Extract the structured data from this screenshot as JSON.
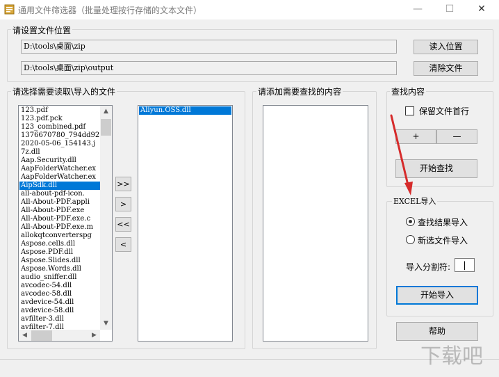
{
  "window": {
    "title": "通用文件筛选器（批量处理按行存储的文本文件）",
    "minimize_glyph": "—",
    "maximize_glyph": "☐",
    "close_glyph": "✕"
  },
  "location_group": {
    "label": "请设置文件位置",
    "path1": "D:\\tools\\桌面\\zip",
    "path2": "D:\\tools\\桌面\\zip\\output",
    "read_button": "读入位置",
    "clear_button": "清除文件"
  },
  "files_group": {
    "label": "请选择需要读取\\导入的文件",
    "source_files": [
      "123.pdf",
      "123.pdf.pck",
      "123_combined.pdf",
      "1376670780_794dd92.",
      "2020-05-06_154143.j",
      "7z.dll",
      "Aap.Security.dll",
      "AapFolderWatcher.ex",
      "AapFolderWatcher.ex",
      "AipSdk.dll",
      "all-about-pdf-icon.",
      "All-About-PDF.appli",
      "All-About-PDF.exe",
      "All-About-PDF.exe.c",
      "All-About-PDF.exe.m",
      "allokqtconverterspg",
      "Aspose.cells.dll",
      "Aspose.PDF.dll",
      "Aspose.Slides.dll",
      "Aspose.Words.dll",
      "audio_sniffer.dll",
      "avcodec-54.dll",
      "avcodec-58.dll",
      "avdevice-54.dll",
      "avdevice-58.dll",
      "avfilter-3.dll",
      "avfilter-7.dll"
    ],
    "selected_source_index": 9,
    "target_files": [
      "Aliyun.OSS.dll"
    ],
    "add_all_button": ">>",
    "add_button": ">",
    "remove_all_button": "<<",
    "remove_button": "<"
  },
  "search_content_group": {
    "label": "请添加需要查找的内容"
  },
  "search_group": {
    "label": "查找内容",
    "keep_first_line_label": "保留文件首行",
    "keep_first_line_checked": false,
    "plus_button": "+",
    "minus_button": "—",
    "start_button": "开始查找"
  },
  "excel_group": {
    "label": "EXCEL导入",
    "radio1_label": "查找结果导入",
    "radio1_checked": true,
    "radio2_label": "新选文件导入",
    "radio2_checked": false,
    "separator_label": "导入分割符:",
    "separator_value": "|",
    "start_button": "开始导入"
  },
  "help_button": "帮助",
  "annotation": {
    "arrow_color": "#d62b2b"
  },
  "colors": {
    "selection": "#0078d7",
    "focus_border": "#0078d7",
    "window_bg": "#f0f0f0"
  },
  "watermark_text": "下载吧"
}
